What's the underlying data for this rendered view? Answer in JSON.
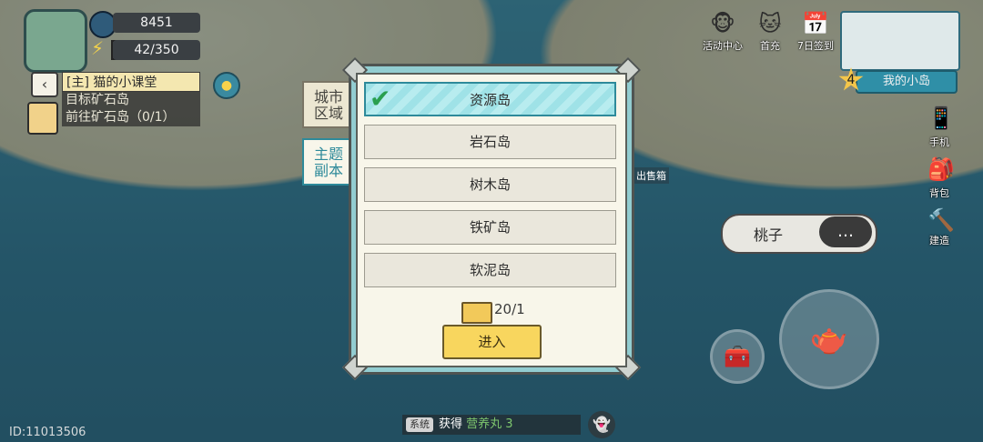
{
  "hud": {
    "currency_value": "8451",
    "energy": "42/350",
    "quest_tag": "[主]",
    "quest_title": "猫的小课堂",
    "quest_line1": "目标矿石岛",
    "quest_line2": "前往矿石岛（0/1）"
  },
  "top_right": {
    "items": [
      {
        "label": "活动中心",
        "icon": "activity-center-icon"
      },
      {
        "label": "首充",
        "icon": "first-recharge-icon"
      },
      {
        "label": "7日签到",
        "icon": "seven-day-signin-icon"
      }
    ],
    "level": "4",
    "island_label": "我的小岛"
  },
  "side": {
    "phone_label": "手机",
    "bag_label": "背包",
    "build_label": "建造"
  },
  "world": {
    "sign_label": "出售箱",
    "chat_name": "桃子",
    "chat_icon": "…"
  },
  "dialog": {
    "tabs": [
      {
        "label": "城市\n区域",
        "active": false
      },
      {
        "label": "主题\n副本",
        "active": true
      }
    ],
    "options": [
      {
        "label": "资源岛",
        "selected": true
      },
      {
        "label": "岩石岛",
        "selected": false
      },
      {
        "label": "树木岛",
        "selected": false
      },
      {
        "label": "铁矿岛",
        "selected": false
      },
      {
        "label": "软泥岛",
        "selected": false
      }
    ],
    "ticket_count": "20/1",
    "enter_label": "进入"
  },
  "system_bar": {
    "tag": "系统",
    "text": "获得",
    "item": "营养丸 3"
  },
  "uid": "ID:11013506"
}
